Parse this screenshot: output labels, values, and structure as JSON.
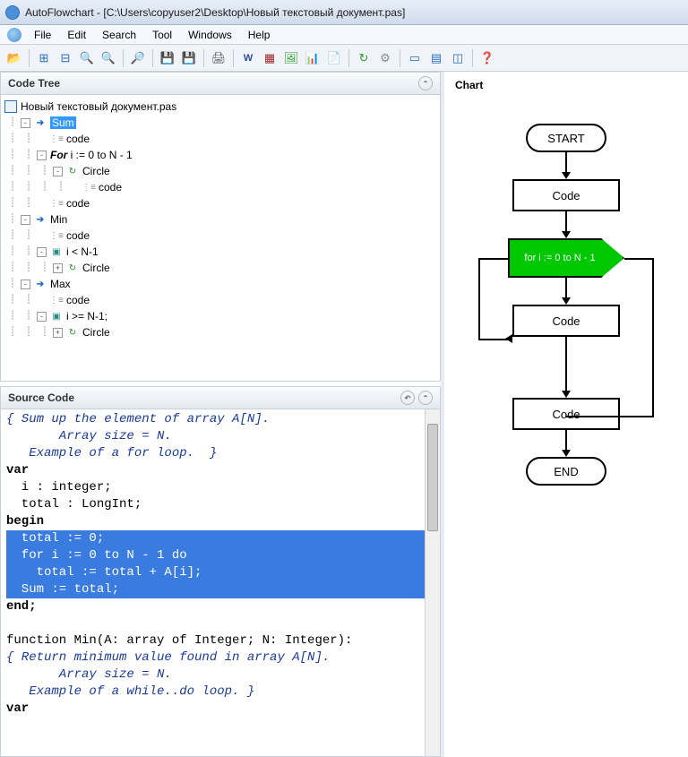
{
  "window": {
    "app": "AutoFlowchart",
    "file": "[C:\\Users\\copyuser2\\Desktop\\Новый текстовый документ.pas]"
  },
  "menu": [
    "File",
    "Edit",
    "Search",
    "Tool",
    "Windows",
    "Help"
  ],
  "panels": {
    "tree": "Code Tree",
    "source": "Source Code",
    "chart": "Chart"
  },
  "tree": {
    "root": "Новый текстовый документ.pas",
    "items": [
      {
        "depth": 1,
        "exp": "-",
        "icon": "arrow",
        "label": "Sum",
        "selected": true
      },
      {
        "depth": 2,
        "exp": "",
        "icon": "code",
        "label": "code"
      },
      {
        "depth": 2,
        "exp": "-",
        "icon": "for",
        "label": "i := 0 to N - 1",
        "bold": "For"
      },
      {
        "depth": 3,
        "exp": "-",
        "icon": "loop",
        "label": "Circle"
      },
      {
        "depth": 4,
        "exp": "",
        "icon": "code",
        "label": "code"
      },
      {
        "depth": 2,
        "exp": "",
        "icon": "code",
        "label": "code"
      },
      {
        "depth": 1,
        "exp": "-",
        "icon": "arrow",
        "label": "Min"
      },
      {
        "depth": 2,
        "exp": "",
        "icon": "code",
        "label": "code"
      },
      {
        "depth": 2,
        "exp": "-",
        "icon": "cond",
        "label": "i < N-1"
      },
      {
        "depth": 3,
        "exp": "+",
        "icon": "loop",
        "label": "Circle"
      },
      {
        "depth": 1,
        "exp": "-",
        "icon": "arrow",
        "label": "Max"
      },
      {
        "depth": 2,
        "exp": "",
        "icon": "code",
        "label": "code"
      },
      {
        "depth": 2,
        "exp": "-",
        "icon": "cond",
        "label": "i >= N-1;"
      },
      {
        "depth": 3,
        "exp": "+",
        "icon": "loop",
        "label": "Circle"
      }
    ]
  },
  "source": {
    "l1": "{ Sum up the element of array A[N].",
    "l2": "       Array size = N.",
    "l3": "   Example of a for loop.  }",
    "l4": "var",
    "l5": "  i : integer;",
    "l6": "  total : LongInt;",
    "l7": "begin",
    "l8": "  total := 0;",
    "l9": "  for i := 0 to N - 1 do",
    "l10": "    total := total + A[i];",
    "l11": "",
    "l12": "  Sum := total;",
    "l13": "end;",
    "l14": "",
    "l15": "function Min(A: array of Integer; N: Integer):",
    "l16": "{ Return minimum value found in array A[N].",
    "l17": "       Array size = N.",
    "l18": "   Example of a while..do loop. }",
    "l19": "var"
  },
  "flow": {
    "start": "START",
    "code1": "Code",
    "loop": "for i := 0 to N - 1",
    "code2": "Code",
    "code3": "Code",
    "end": "END"
  }
}
